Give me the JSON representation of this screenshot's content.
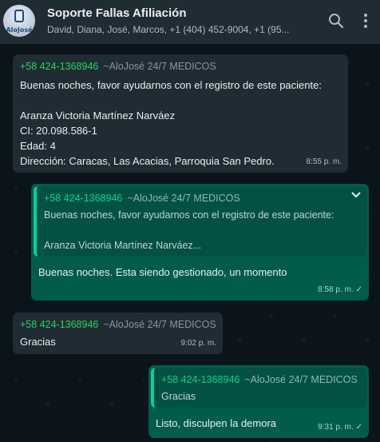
{
  "header": {
    "avatar_text": "AloJosé",
    "title": "Soporte Fallas Afiliación",
    "subtitle": "David, Diana, José, Marcos, +1 (404) 452-9004, +1 (95..."
  },
  "messages": [
    {
      "sender_number": "+58 424-1368946",
      "sender_alias": "~AloJosé 24/7 MEDICOS",
      "text": "Buenas noches, favor ayudarnos con el registro de este paciente:\n\nAranza Victoria Martínez Narváez\nCI: 20.098.586-1\nEdad: 4\nDirección: Caracas, Las Acacias, Parroquia San Pedro.",
      "time": "8:55 p. m."
    },
    {
      "quote_number": "+58 424-1368946",
      "quote_alias": "~AloJosé 24/7 MEDICOS",
      "quote_text": "Buenas noches, favor ayudarnos con el registro de este paciente:\n\nAranza Victoria Martínez Narváez...",
      "text": "Buenas noches. Esta siendo gestionado, un momento",
      "time": "8:58 p. m."
    },
    {
      "sender_number": "+58 424-1368946",
      "sender_alias": "~AloJosé 24/7 MEDICOS",
      "text": "Gracias",
      "time": "9:02 p. m."
    },
    {
      "quote_number": "+58 424-1368946",
      "quote_alias": "~AloJosé 24/7 MEDICOS",
      "quote_text": "Gracias",
      "text": "Listo, disculpen la demora",
      "time": "9:31 p. m."
    }
  ],
  "icons": {
    "search": "search-icon",
    "menu": "more-vertical-icon",
    "read_receipt": "check-icon",
    "message_menu": "chevron-down-icon"
  },
  "colors": {
    "header_bg": "#202c33",
    "incoming_bubble": "#202c33",
    "outgoing_bubble": "#005c4b",
    "quote_accent": "#06cf9c",
    "sender_name": "#53bdeb"
  }
}
